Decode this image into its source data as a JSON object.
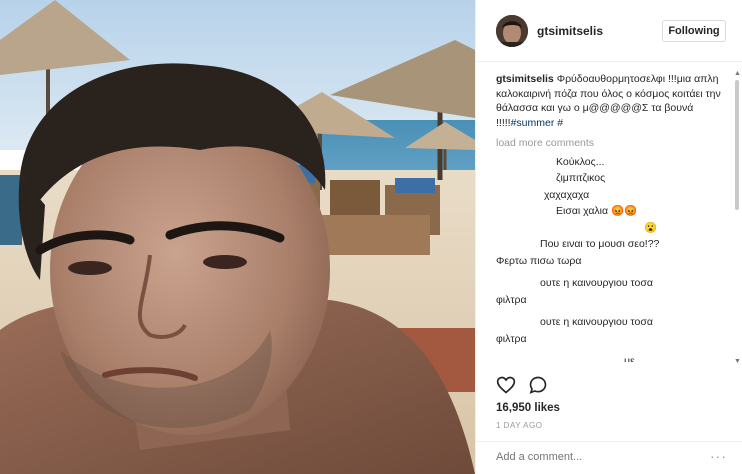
{
  "post": {
    "username": "gtsimitselis",
    "follow_label": "Following",
    "caption_user": "gtsimitselis",
    "caption_text": "Φρύδοαυθορμητοσελφι !!!μια απλη καλοκαιρινή πόζα που όλος ο κόσμος κοιτάει την θάλασσα και γω ο μ@@@@@Σ τα βουνά !!!!!",
    "caption_hashtag": "#summer #",
    "load_more": "load more comments",
    "comments": [
      {
        "blur": "",
        "text": "Κούκλος..."
      },
      {
        "blur": "",
        "text": "ζιμπιτζικος"
      },
      {
        "blur": "",
        "text": "χαχαχαχα"
      },
      {
        "blur": "",
        "text": "Εισαι χαλια 😡😡"
      },
      {
        "blur": "",
        "text": "😮"
      },
      {
        "blur": "",
        "text": "Που ειναι το μουσι σεο!??"
      },
      {
        "blur": "",
        "text": "Φερτω πισω τωρα"
      },
      {
        "blur": "",
        "text": "ουτε η καινουργιου τοσα"
      },
      {
        "blur": "",
        "text": "φιλτρα"
      },
      {
        "blur": "",
        "text": "ουτε η καινουργιου τοσα"
      },
      {
        "blur": "",
        "text": "φιλτρα"
      },
      {
        "blur": "",
        "text": "με"
      }
    ],
    "likes": "16,950 likes",
    "date": "1 DAY AGO",
    "comment_placeholder": "Add a comment...",
    "more_icon": "···"
  },
  "icons": {
    "like": "heart-icon",
    "comment": "speech-bubble-icon",
    "more": "more-options-icon"
  },
  "colors": {
    "link": "#003569",
    "muted": "#999999",
    "border": "#efefef"
  }
}
